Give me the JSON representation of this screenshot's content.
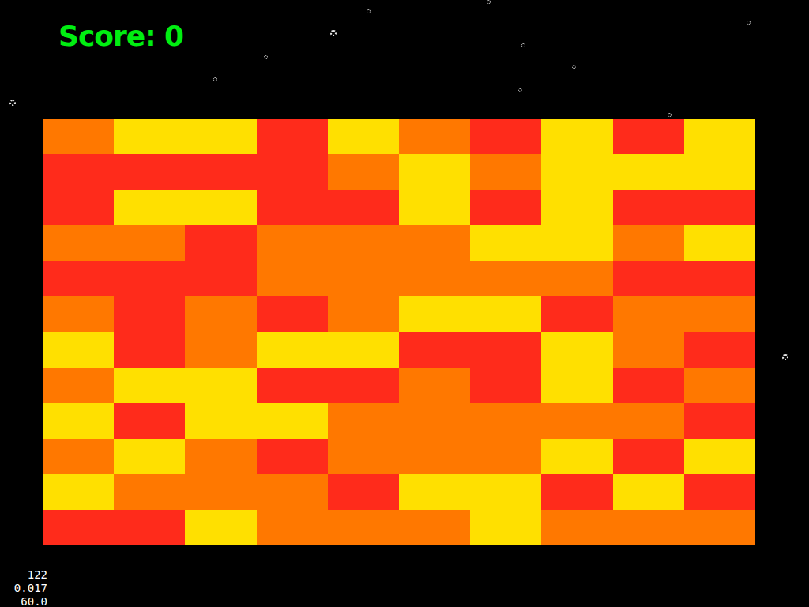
{
  "score": {
    "text": "Score: 0"
  },
  "bricks": [
    [
      "#ff7800",
      "#ffe000",
      "#ffe000",
      "#ff2b1b",
      "#ffe000",
      "#ff7800",
      "#ff2b1b",
      "#ffe000",
      "#ff2b1b",
      "#ffe000"
    ],
    [
      "#ff2b1b",
      "#ff2b1b",
      "#ff2b1b",
      "#ff2b1b",
      "#ff7800",
      "#ffe000",
      "#ff7800",
      "#ffe000",
      "#ffe000",
      "#ffe000"
    ],
    [
      "#ff2b1b",
      "#ffe000",
      "#ffe000",
      "#ff2b1b",
      "#ff2b1b",
      "#ffe000",
      "#ff2b1b",
      "#ffe000",
      "#ff2b1b",
      "#ff2b1b"
    ],
    [
      "#ff7800",
      "#ff7800",
      "#ff2b1b",
      "#ff7800",
      "#ff7800",
      "#ff7800",
      "#ffe000",
      "#ffe000",
      "#ff7800",
      "#ffe000"
    ],
    [
      "#ff2b1b",
      "#ff2b1b",
      "#ff2b1b",
      "#ff7800",
      "#ff7800",
      "#ff7800",
      "#ff7800",
      "#ff7800",
      "#ff2b1b",
      "#ff2b1b"
    ],
    [
      "#ff7800",
      "#ff2b1b",
      "#ff7800",
      "#ff2b1b",
      "#ff7800",
      "#ffe000",
      "#ffe000",
      "#ff2b1b",
      "#ff7800",
      "#ff7800"
    ],
    [
      "#ffe000",
      "#ff2b1b",
      "#ff7800",
      "#ffe000",
      "#ffe000",
      "#ff2b1b",
      "#ff2b1b",
      "#ffe000",
      "#ff7800",
      "#ff2b1b"
    ],
    [
      "#ff7800",
      "#ffe000",
      "#ffe000",
      "#ff2b1b",
      "#ff2b1b",
      "#ff7800",
      "#ff2b1b",
      "#ffe000",
      "#ff2b1b",
      "#ff7800"
    ],
    [
      "#ffe000",
      "#ff2b1b",
      "#ffe000",
      "#ffe000",
      "#ff7800",
      "#ff7800",
      "#ff7800",
      "#ff7800",
      "#ff7800",
      "#ff2b1b"
    ],
    [
      "#ff7800",
      "#ffe000",
      "#ff7800",
      "#ff2b1b",
      "#ff7800",
      "#ff7800",
      "#ff7800",
      "#ffe000",
      "#ff2b1b",
      "#ffe000"
    ],
    [
      "#ffe000",
      "#ff7800",
      "#ff7800",
      "#ff7800",
      "#ff2b1b",
      "#ffe000",
      "#ffe000",
      "#ff2b1b",
      "#ffe000",
      "#ff2b1b"
    ],
    [
      "#ff2b1b",
      "#ff2b1b",
      "#ffe000",
      "#ff7800",
      "#ff7800",
      "#ff7800",
      "#ffe000",
      "#ff7800",
      "#ff7800",
      "#ff7800"
    ]
  ],
  "debug": [
    "122",
    "0.017",
    "60.0"
  ]
}
